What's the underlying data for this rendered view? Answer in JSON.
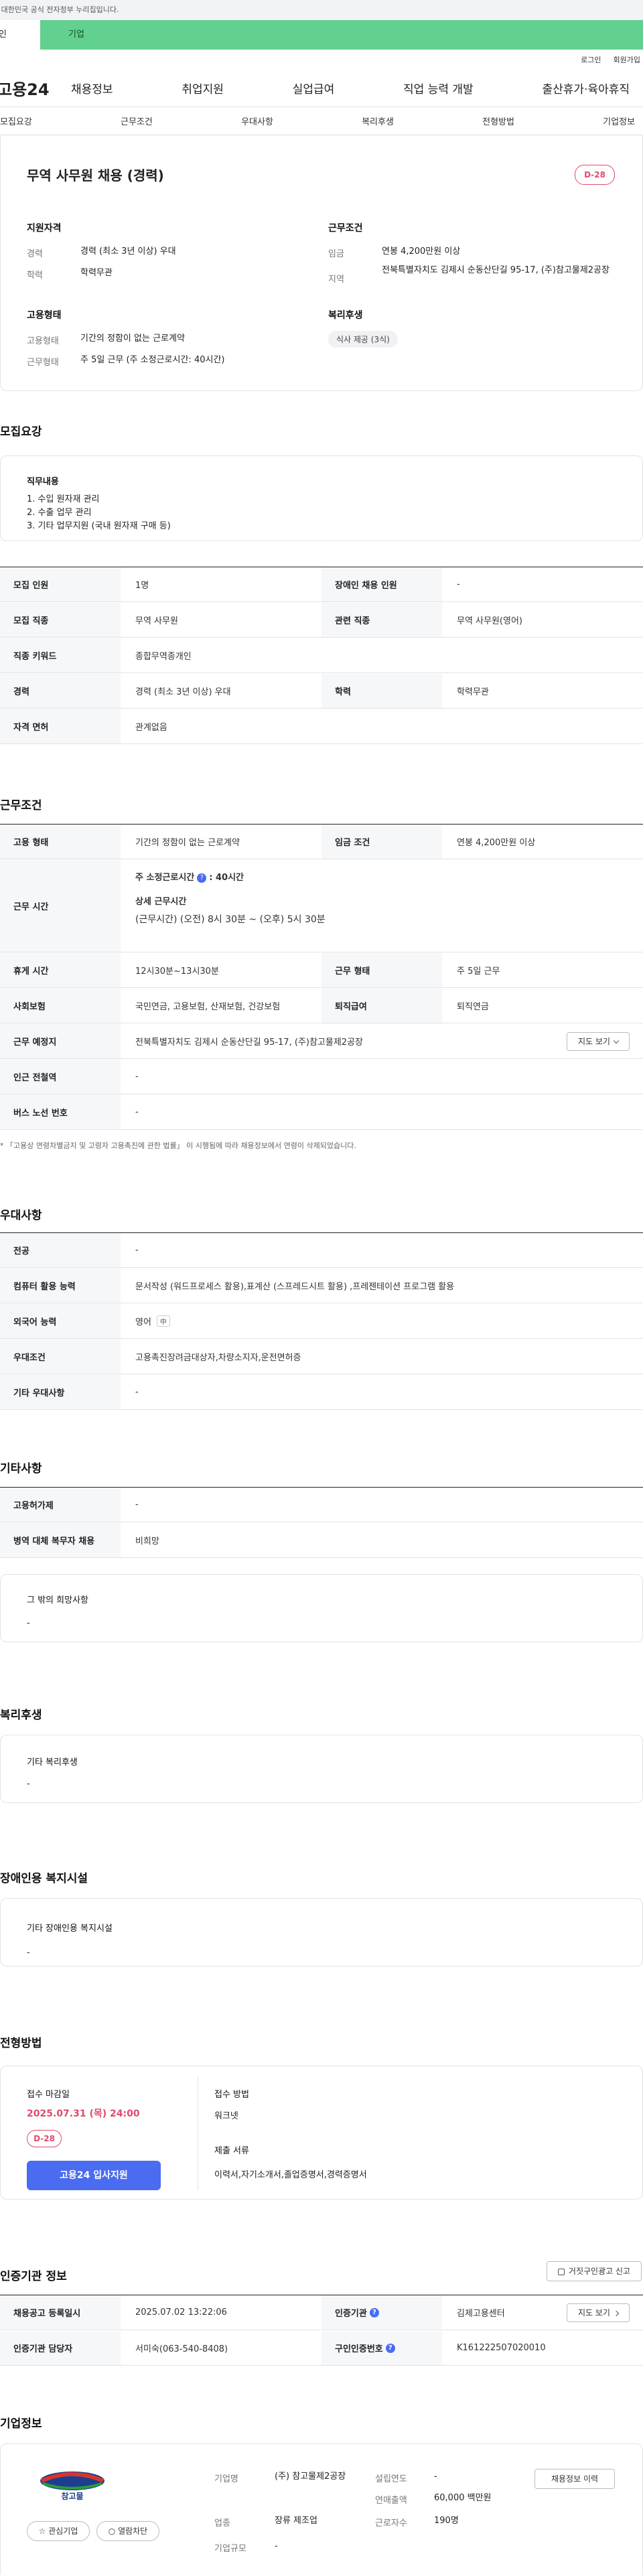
{
  "gov_banner": "이 누리집은 대한민국 공식 전자정부 누리집입니다.",
  "user_tabs": {
    "personal": "개인",
    "company": "기업"
  },
  "util": {
    "login": "로그인",
    "signup": "회원가입"
  },
  "logo": "고용24",
  "gnb": [
    "채용정보",
    "취업지원",
    "실업급여",
    "직업 능력 개발",
    "출산휴가·육아휴직",
    "기업정보"
  ],
  "subnav": [
    "모집요강",
    "근무조건",
    "우대사항",
    "복리후생",
    "전형방법",
    "기업정보"
  ],
  "summary": {
    "title": "무역 사무원 채용 (경력)",
    "dday": "D-28",
    "apply_group": "지원자격",
    "career_label": "경력",
    "career_value": "경력 (최소 3년 이상) 우대",
    "edu_label": "학력",
    "edu_value": "학력무관",
    "work_group": "근무조건",
    "wage_label": "임금",
    "wage_value": "연봉 4,200만원 이상",
    "area_label": "지역",
    "area_value": "전북특별자치도 김제시 순동산단길 95-17, (주)참고물제2공장",
    "emp_group": "고용형태",
    "emptype_label": "고용형태",
    "emptype_value": "기간의 정함이 없는 근로계약",
    "hours_label": "근무형태",
    "hours_value": "주 5일 근무 (주 소정근로시간: 40시간)",
    "welfare_group": "복리후생",
    "welfare_tag": "식사 제공 (3식)"
  },
  "recruit": {
    "title": "모집요강",
    "duty_title": "직무내용",
    "duties": [
      "1. 수입 원자재 관리",
      "2. 수출 업무 관리",
      "3. 기타 업무지원 (국내 원자재 구매 등)"
    ],
    "rows": [
      {
        "l1": "모집 인원",
        "v1": "1명",
        "l2": "장애인 채용 인원",
        "v2": "-"
      },
      {
        "l1": "모집 직종",
        "v1": "무역 사무원",
        "l2": "관련 직종",
        "v2": "무역 사무원(영어)"
      },
      {
        "l1": "직종 키워드",
        "v1": "종합무역종개인",
        "l2": "",
        "v2": ""
      },
      {
        "l1": "경력",
        "v1": "경력 (최소 3년 이상) 우대",
        "l2": "학력",
        "v2": "학력무관"
      },
      {
        "l1": "자격 면허",
        "v1": "관계없음",
        "l2": "",
        "v2": ""
      }
    ]
  },
  "conditions": {
    "title": "근무조건",
    "emp_label": "고용 형태",
    "emp_value": "기간의 정함이 없는 근로계약",
    "wage_label": "임금 조건",
    "wage_value": "연봉 4,200만원 이상",
    "hours_label": "근무 시간",
    "hours_weekly_label": "주 소정근로시간",
    "hours_weekly_value": ": 40시간",
    "hours_detail_label": "상세 근무시간",
    "hours_detail_value": "(근무시간) (오전) 8시 30분 ~ (오후) 5시 30분",
    "break_label": "휴게 시간",
    "break_value": "12시30분~13시30분",
    "form_label": "근무 형태",
    "form_value": "주 5일 근무",
    "insurance_label": "사회보험",
    "insurance_value": "국민연금, 고용보험, 산재보험, 건강보험",
    "retire_label": "퇴직급여",
    "retire_value": "퇴직연금",
    "location_label": "근무 예정지",
    "location_value": "전북특별자치도 김제시 순동산단길 95-17, (주)참고물제2공장",
    "map_button": "지도 보기",
    "subway_label": "인근 전철역",
    "subway_value": "-",
    "bus_label": "버스 노선 번호",
    "bus_value": "-",
    "note": "* 「고용상 연령차별금지 및 고령자 고용촉진에 관한 법률」 이 시행됨에 따라 채용정보에서 연령이 삭제되었습니다."
  },
  "prefer": {
    "title": "우대사항",
    "major_label": "전공",
    "major_value": "-",
    "computer_label": "컴퓨터 활용 능력",
    "computer_value": "문서작성 (워드프로세스 활용),표계산 (스프레드시트 활용) ,프레젠테이션 프로그램 활용",
    "lang_label": "외국어 능력",
    "lang_value": "영어",
    "lang_tag": "中",
    "cond_label": "우대조건",
    "cond_value": "고용촉진장려금대상자,차량소지자,운전면허증",
    "etc_label": "기타 우대사항",
    "etc_value": "-"
  },
  "other": {
    "title": "기타사항",
    "hire_label": "고용허가제",
    "hire_value": "-",
    "mil_label": "병역 대체 복무자 채용",
    "mil_value": "비희망",
    "wish_title": "그 밖의 희망사항",
    "wish_value": "-"
  },
  "welfare": {
    "title": "복리후생",
    "box_title": "기타 복리후생",
    "box_value": "-"
  },
  "disabled": {
    "title": "장애인용 복지시설",
    "box_title": "기타 장애인용 복지시설",
    "box_value": "-"
  },
  "screening": {
    "title": "전형방법",
    "deadline_label": "접수 마감일",
    "deadline_value": "2025.07.31 (목) 24:00",
    "dday": "D-28",
    "apply_button": "고용24 입사지원",
    "method_label": "접수 방법",
    "method_value": "워크넷",
    "docs_label": "제출 서류",
    "docs_value": "이력서,자기소개서,졸업증명서,경력증명서"
  },
  "cert": {
    "title": "인증기관 정보",
    "report_button": "거짓구인광고 신고",
    "reg_label": "채용공고 등록일시",
    "reg_value": "2025.07.02 13:22:06",
    "org_label": "인증기관",
    "org_value": "김제고용센터",
    "map_button": "지도 보기",
    "manager_label": "인증기관 담당자",
    "manager_value": "서미숙(063-540-8408)",
    "num_label": "구인인증번호",
    "num_value": "K161222507020010"
  },
  "company": {
    "title": "기업정보",
    "logo_text": "참고물",
    "fav_button": "관심기업",
    "read_button": "열람차단",
    "name_label": "기업명",
    "name_value": "(주) 참고물제2공장",
    "industry_label": "업종",
    "industry_value": "장류 제조업",
    "size_label": "기업규모",
    "size_value": "-",
    "year_label": "설립연도",
    "year_value": "-",
    "sales_label": "연매출액",
    "sales_value": "60,000 백만원",
    "staff_label": "근로자수",
    "staff_value": "190명",
    "history_button": "채용정보 이력"
  },
  "colors": {
    "accent": "#4a6cf0",
    "dday": "#e24a6b",
    "company_tab": "#62d08e"
  }
}
